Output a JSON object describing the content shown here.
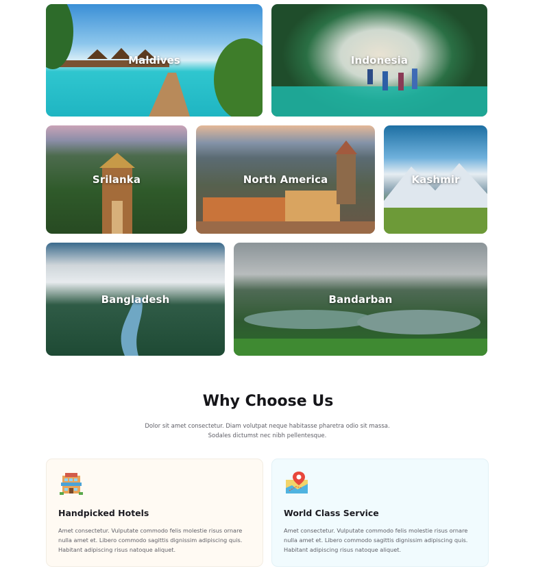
{
  "destinations": [
    {
      "name": "Maldives"
    },
    {
      "name": "Indonesia"
    },
    {
      "name": "Srilanka"
    },
    {
      "name": "North America"
    },
    {
      "name": "Kashmir"
    },
    {
      "name": "Bangladesh"
    },
    {
      "name": "Bandarban"
    }
  ],
  "why": {
    "title": "Why Choose Us",
    "description_line1": "Dolor sit amet consectetur. Diam volutpat neque habitasse pharetra odio sit massa.",
    "description_line2": "Sodales dictumst nec nibh pellentesque."
  },
  "features": [
    {
      "icon": "hotel-icon",
      "title": "Handpicked Hotels",
      "text": "Amet consectetur. Vulputate commodo felis molestie risus  ornare nulla amet et. Libero commodo sagittis dignissim adipiscing quis. Habitant adipiscing risus natoque aliquet.",
      "bg_color": "#fffaf3"
    },
    {
      "icon": "map-pin-icon",
      "title": "World Class Service",
      "text": "Amet consectetur. Vulputate commodo felis molestie risus  ornare nulla amet et. Libero commodo sagittis dignissim adipiscing quis. Habitant adipiscing risus natoque aliquet.",
      "bg_color": "#f1fbfe"
    }
  ]
}
